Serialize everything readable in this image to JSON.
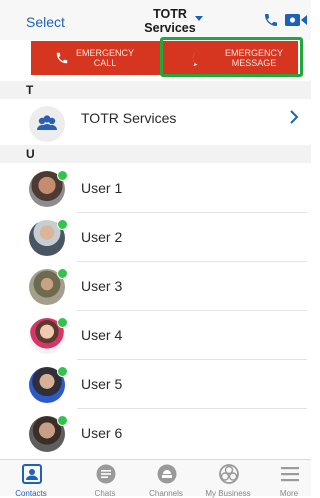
{
  "header": {
    "select_label": "Select",
    "title_line1": "TOTR",
    "title_line2": "Services",
    "icons": [
      "phone-icon",
      "video-call-icon",
      "chevron-down-icon"
    ]
  },
  "emergency": {
    "call_label": "EMERGENCY CALL",
    "message_label": "EMERGENCY MESSAGE",
    "colors": {
      "bar": "#d6361f",
      "highlight": "#22a83a"
    }
  },
  "sections": [
    {
      "letter": "T"
    },
    {
      "letter": "U"
    }
  ],
  "group_row": {
    "label": "TOTR Services",
    "icon": "group-icon"
  },
  "contacts": [
    {
      "name": "User 1",
      "status": "online"
    },
    {
      "name": "User 2",
      "status": "online"
    },
    {
      "name": "User 3",
      "status": "online"
    },
    {
      "name": "User 4",
      "status": "online"
    },
    {
      "name": "User 5",
      "status": "online"
    },
    {
      "name": "User 6",
      "status": "online"
    }
  ],
  "tabs": [
    {
      "label": "Contacts",
      "icon": "contacts-icon",
      "active": true
    },
    {
      "label": "Chats",
      "icon": "chats-icon",
      "active": false
    },
    {
      "label": "Channels",
      "icon": "channels-icon",
      "active": false
    },
    {
      "label": "My Business",
      "icon": "my-business-icon",
      "active": false
    },
    {
      "label": "More",
      "icon": "hamburger-menu-icon",
      "active": false
    }
  ],
  "colors": {
    "accent": "#1d62b7",
    "online": "#31c34a"
  }
}
